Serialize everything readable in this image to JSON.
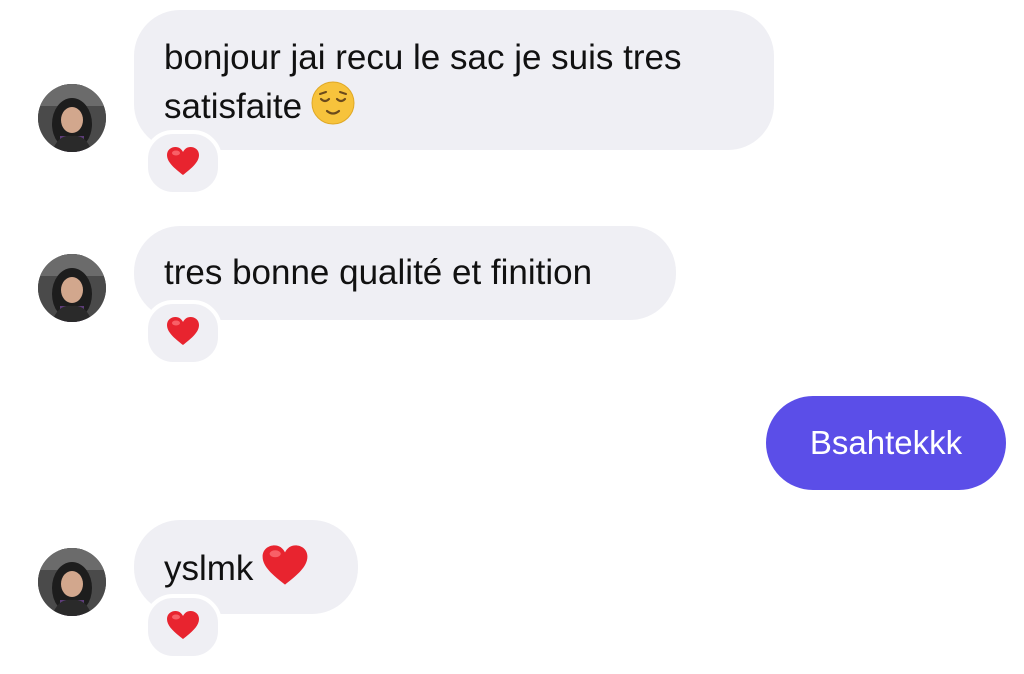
{
  "conversation": {
    "messages": [
      {
        "sender": "other",
        "text": "bonjour jai recu le sac je suis tres\nsatisfaite",
        "emoji": "relieved-face",
        "reaction": "heart"
      },
      {
        "sender": "other",
        "text": "tres bonne qualité et finition",
        "reaction": "heart"
      },
      {
        "sender": "me",
        "text": "Bsahtekkk"
      },
      {
        "sender": "other",
        "text": "yslmk",
        "emoji": "red-heart",
        "reaction": "heart"
      }
    ]
  },
  "colors": {
    "incoming_bubble": "#efeff4",
    "outgoing_bubble": "#5b4ee8",
    "reaction_heart": "#e8242f"
  }
}
